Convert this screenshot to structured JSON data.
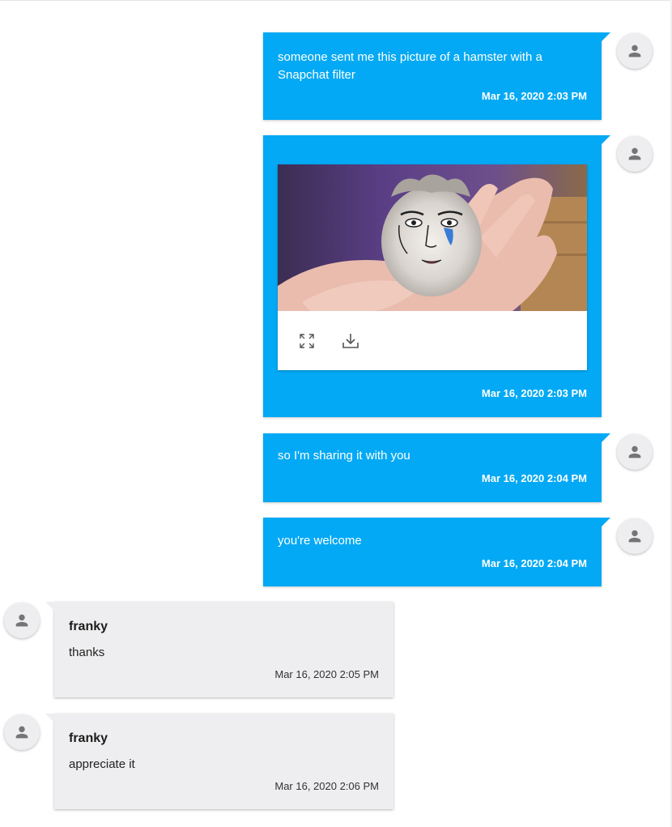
{
  "colors": {
    "outgoing_bubble": "#03a9f4",
    "incoming_bubble": "#eeeef0",
    "avatar_bg": "#eeeef0",
    "avatar_icon": "#757575"
  },
  "icons": {
    "avatar": "person-icon",
    "expand": "fullscreen-icon",
    "download": "download-icon"
  },
  "messages": [
    {
      "direction": "outgoing",
      "text": "someone sent me this picture of a hamster with a Snapchat filter",
      "time": "Mar 16, 2020 2:03 PM"
    },
    {
      "direction": "outgoing",
      "attachment": "image",
      "time": "Mar 16, 2020 2:03 PM"
    },
    {
      "direction": "outgoing",
      "text": "so I'm sharing it with you",
      "time": "Mar 16, 2020 2:04 PM"
    },
    {
      "direction": "outgoing",
      "text": "you're welcome",
      "time": "Mar 16, 2020 2:04 PM"
    },
    {
      "direction": "incoming",
      "sender": "franky",
      "text": "thanks",
      "time": "Mar 16, 2020 2:05 PM"
    },
    {
      "direction": "incoming",
      "sender": "franky",
      "text": "appreciate it",
      "time": "Mar 16, 2020 2:06 PM"
    }
  ]
}
